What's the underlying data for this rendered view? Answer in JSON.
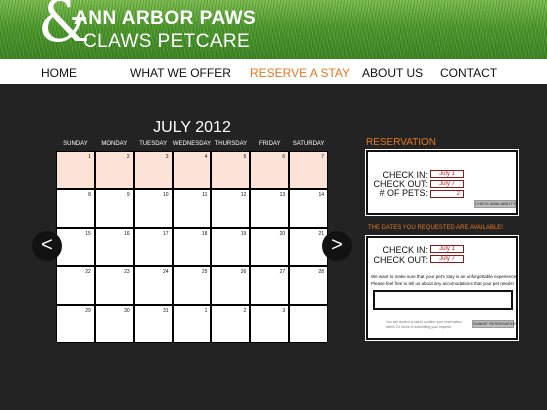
{
  "brand": {
    "ampersand": "&",
    "line1": "ANN ARBOR PAWS",
    "line2": "CLAWS PETCARE"
  },
  "nav": {
    "items": [
      {
        "label": "HOME"
      },
      {
        "label": "WHAT WE OFFER"
      },
      {
        "label": "RESERVE A STAY",
        "active": true
      },
      {
        "label": "ABOUT US"
      },
      {
        "label": "CONTACT"
      }
    ]
  },
  "colors": {
    "accent": "#e87722",
    "background": "#232323",
    "selected_day": "#fde3d7",
    "value_text": "#c02020"
  },
  "calendar": {
    "month": "JULY 2012",
    "day_names": [
      "SUNDAY",
      "MONDAY",
      "TUESDAY",
      "WEDNESDAY",
      "THURSDAY",
      "FRIDAY",
      "SATURDAY"
    ],
    "weeks": [
      [
        {
          "d": "1",
          "sel": true
        },
        {
          "d": "2",
          "sel": true
        },
        {
          "d": "3",
          "sel": true
        },
        {
          "d": "4",
          "sel": true
        },
        {
          "d": "5",
          "sel": true
        },
        {
          "d": "6",
          "sel": true
        },
        {
          "d": "7",
          "sel": true
        }
      ],
      [
        {
          "d": "8"
        },
        {
          "d": "9"
        },
        {
          "d": "10"
        },
        {
          "d": "11"
        },
        {
          "d": "12"
        },
        {
          "d": "13"
        },
        {
          "d": "14"
        }
      ],
      [
        {
          "d": "15"
        },
        {
          "d": "16"
        },
        {
          "d": "17"
        },
        {
          "d": "18"
        },
        {
          "d": "19"
        },
        {
          "d": "20"
        },
        {
          "d": "21"
        }
      ],
      [
        {
          "d": "22"
        },
        {
          "d": "23"
        },
        {
          "d": "24"
        },
        {
          "d": "25"
        },
        {
          "d": "26"
        },
        {
          "d": "27"
        },
        {
          "d": "28"
        }
      ],
      [
        {
          "d": "29"
        },
        {
          "d": "30"
        },
        {
          "d": "31"
        },
        {
          "d": "1"
        },
        {
          "d": "2"
        },
        {
          "d": "3"
        },
        {
          "d": ""
        }
      ]
    ],
    "prev": "<",
    "next": ">"
  },
  "reservation": {
    "title": "RESERVATION",
    "check_in_label": "CHECK IN:",
    "check_in_value": "July 1",
    "check_out_label": "CHECK OUT:",
    "check_out_value": "July 7",
    "pets_label": "# OF PETS:",
    "pets_value": "2",
    "check_button": "CHECK AVAILABILITY"
  },
  "availability": {
    "banner": "THE DATES YOU REQUESTED ARE AVAILABLE!",
    "check_in_label": "CHECK IN:",
    "check_in_value": "July 1",
    "check_out_label": "CHECK OUT:",
    "check_out_value": "July 7",
    "message_line1": "We want to make sure that your pet's stay is an unforgettable experience!",
    "message_line2": "Please feel free to tell us about any accomodations that your pet needs!",
    "notes_value": "",
    "confirm_line1": "You will receive a call to confirm your reservation",
    "confirm_line2": "within 24 hours of submitting your request.",
    "submit_button": "SUBMIT RESERVATION"
  }
}
